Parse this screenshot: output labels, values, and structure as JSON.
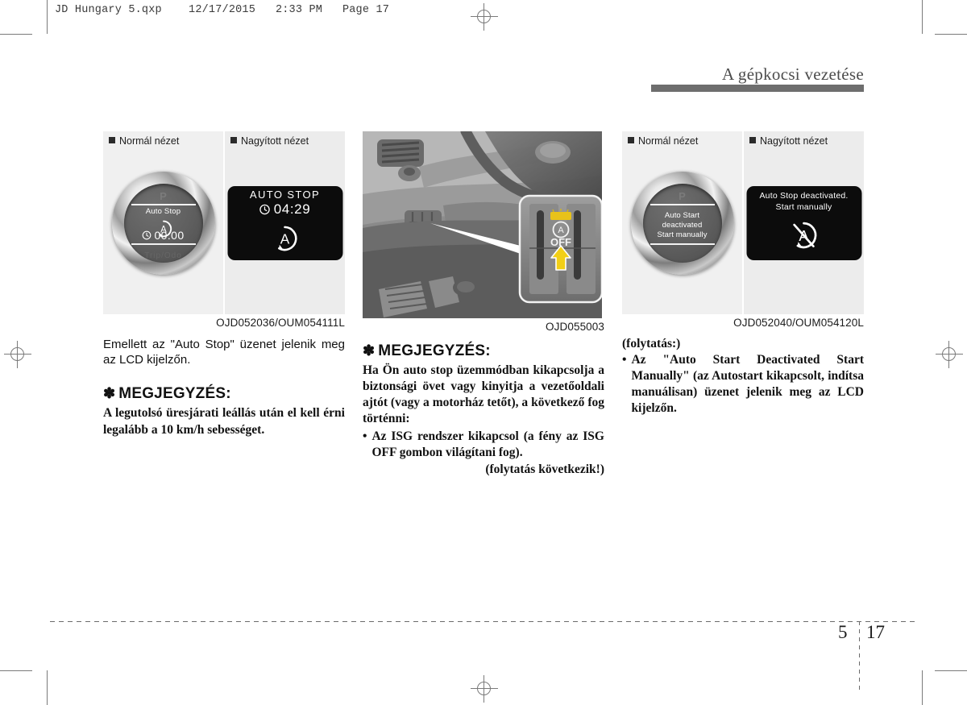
{
  "file_header": "JD Hungary 5.qxp    12/17/2015   2:33 PM   Page 17",
  "running_head": "A gépkocsi vezetése",
  "footer": {
    "section": "5",
    "page": "17"
  },
  "labels": {
    "normal_view": "Normál nézet",
    "magnified_view": "Nagyított nézet"
  },
  "figures": {
    "fig1": {
      "caption": "OJD052036/OUM054111L",
      "gauge": {
        "gear": "P",
        "title": "Auto Stop",
        "timer": "00:00",
        "ghost": "Trip/Odo"
      },
      "lcd": {
        "line1": "AUTO STOP",
        "line2": "04:29"
      }
    },
    "fig2": {
      "caption": "OJD055003",
      "callout_button": "OFF"
    },
    "fig3": {
      "caption": "OJD052040/OUM054120L",
      "gauge": {
        "gear": "P",
        "message": "Auto Start\ndeactivated\nStart manually"
      },
      "lcd": {
        "message": "Auto Stop  deactivated.\nStart manually"
      }
    }
  },
  "col1": {
    "intro": "Emellett az \"Auto Stop\" üzenet jelenik meg az LCD kijelzőn.",
    "note_heading": "MEGJEGYZÉS:",
    "note_body": "A legutolsó üresjárati leállás után el kell érni legalább a 10 km/h sebességet."
  },
  "col2": {
    "note_heading": "MEGJEGYZÉS:",
    "note_body": "Ha Ön auto stop üzemmódban kikapcsolja a biztonsági övet vagy kinyitja a vezetőoldali ajtót (vagy a motorház tetőt), a következő fog történni:",
    "bullets": [
      "Az ISG rendszer kikapcsol (a fény az ISG OFF gombon világítani fog)."
    ],
    "continued": "(folytatás következik!)"
  },
  "col3": {
    "continued_lead": "(folytatás:)",
    "bullets": [
      "Az \"Auto Start Deactivated Start Manually\" (az Autostart kikapcsolt, indítsa manuálisan) üzenet jelenik meg az LCD kijelzőn."
    ]
  },
  "icons": {
    "asterisk": "✽",
    "bullet": "•",
    "clock": "clock-icon",
    "auto_stop": "auto-stop-a-icon",
    "auto_stop_off": "auto-stop-disabled-icon"
  },
  "colors": {
    "rule": "#6e6e6e",
    "lcd_bg": "#0c0c0c",
    "panel_left": "#f0f0f0",
    "panel_right": "#ececec",
    "accent_yellow": "#f2cf17"
  }
}
